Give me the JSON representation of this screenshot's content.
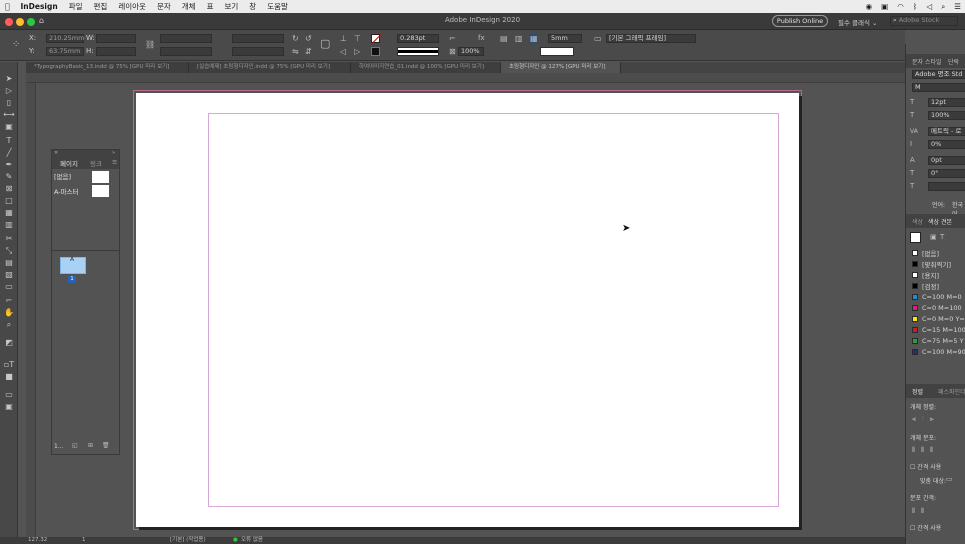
{
  "menubar": {
    "app": "InDesign",
    "items": [
      "파일",
      "편집",
      "레이아웃",
      "문자",
      "개체",
      "표",
      "보기",
      "창",
      "도움말"
    ]
  },
  "titlebar": {
    "title": "Adobe InDesign 2020",
    "publish": "Publish Online",
    "workspace": "필수 클래식 ⌄",
    "stock_placeholder": "Adobe Stock"
  },
  "control": {
    "x_label": "X:",
    "x_value": "210.25mm",
    "y_label": "Y:",
    "y_value": "63.75mm",
    "w_label": "W:",
    "h_label": "H:",
    "stroke_weight": "0.283pt",
    "opacity": "100%",
    "gap": "5mm",
    "frame_style": "[기본 그래픽 프레임]"
  },
  "tabs": [
    {
      "label": "*TypographyBasic_13.indd @ 75% [GPU 미리 보기]"
    },
    {
      "label": "[실습예제] 초링형디자인.indd @ 75% [GPU 미리 보기]"
    },
    {
      "label": "하여아미지연습_01.indd @ 100% [GPU 미리 보기]"
    },
    {
      "label": "초링형디자인 @ 127% [GPU 미리 보기]"
    }
  ],
  "pages_panel": {
    "tab_pages": "페이지",
    "tab_links": "링크",
    "none_label": "[없음]",
    "master_label": "A-마스터",
    "page_number": "1",
    "footer_label": "1..."
  },
  "right_panel": {
    "tab_char": "문자 스타일",
    "tab_para": "단락",
    "font": "Adobe 명조 Std",
    "font_style": "M",
    "size": "12pt",
    "leading": "100%",
    "kerning": "메트릭 - 로",
    "tracking": "0%",
    "baseline": "0pt",
    "skew": "0°",
    "language_label": "언어:",
    "language": "한국어",
    "tab_color": "색상",
    "tab_swatch": "색상 견본",
    "swatches": [
      {
        "name": "[없음]",
        "color": "#ffffff"
      },
      {
        "name": "[맞춰찍기]",
        "color": "#000000"
      },
      {
        "name": "[용지]",
        "color": "#ffffff"
      },
      {
        "name": "[검정]",
        "color": "#000000"
      },
      {
        "name": "C=100 M=0",
        "color": "#1a8fd6"
      },
      {
        "name": "C=0 M=100",
        "color": "#d6227a"
      },
      {
        "name": "C=0 M=0 Y=",
        "color": "#ffe600"
      },
      {
        "name": "C=15 M=100",
        "color": "#c81c2a"
      },
      {
        "name": "C=75 M=5 Y",
        "color": "#2b9a3b"
      },
      {
        "name": "C=100 M=90",
        "color": "#23306e"
      }
    ],
    "tab_align": "정렬",
    "tab_pathfinder": "패스파인더",
    "align_objects": "개체 정렬:",
    "distribute_objects": "개체 분포:",
    "use_spacing": "간격 사용",
    "align_to": "맞춤 대상:",
    "distribute_spacing": "분포 간격:",
    "use_spacing2": "간격 사용"
  },
  "status": {
    "zoom": "127.32",
    "page": "1",
    "style": "[기본] (작업용)",
    "preflight": "오류 없음"
  },
  "colors": {
    "bleed": "#b46a8f",
    "margin": "#d9a8d9",
    "page_thumb": "#a9d0f5"
  }
}
